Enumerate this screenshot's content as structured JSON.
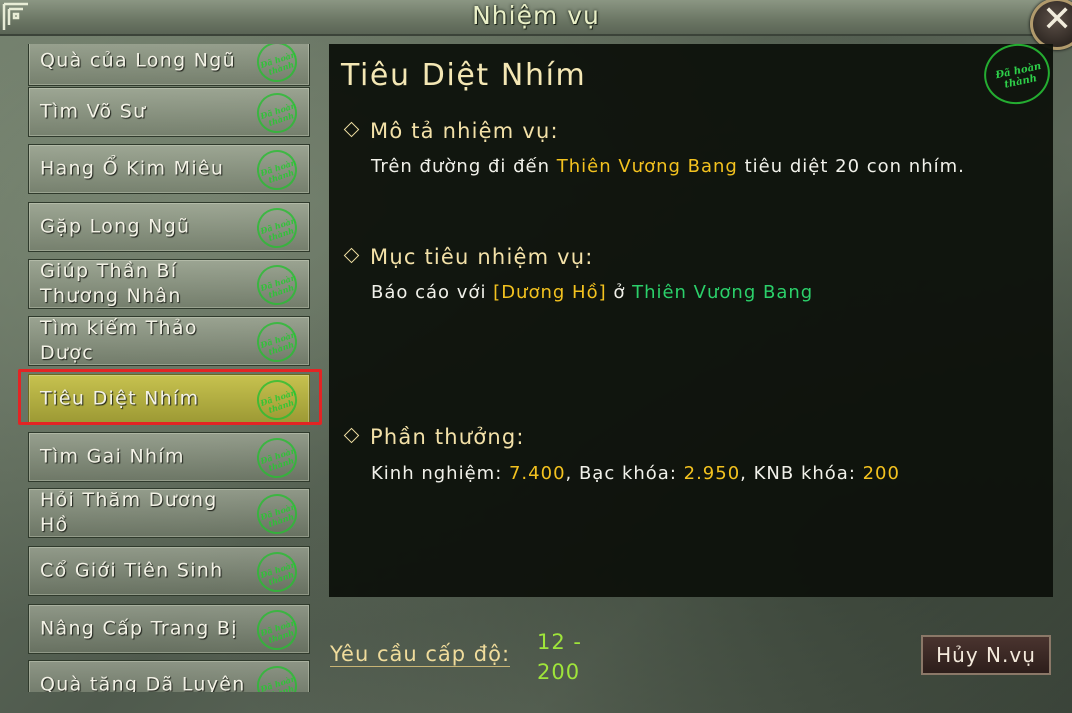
{
  "window": {
    "title": "Nhiệm vụ",
    "close_icon": "close-icon"
  },
  "quest_list": [
    {
      "label": "Quà của Long Ngũ",
      "stamp": "Đã hoàn thành"
    },
    {
      "label": "Tìm Võ Sư",
      "stamp": "Đã hoàn thành"
    },
    {
      "label": "Hang Ổ Kim Miêu",
      "stamp": "Đã hoàn thành"
    },
    {
      "label": "Gặp Long Ngũ",
      "stamp": "Đã hoàn thành"
    },
    {
      "label": "Giúp Thần Bí Thương Nhân",
      "stamp": "Đã hoàn thành"
    },
    {
      "label": "Tìm kiếm Thảo Dược",
      "stamp": "Đã hoàn thành"
    },
    {
      "label": "Tiêu Diệt Nhím",
      "stamp": "Đã hoàn thành",
      "selected": true
    },
    {
      "label": "Tìm Gai Nhím",
      "stamp": "Đã hoàn thành"
    },
    {
      "label": "Hỏi Thăm Dương Hồ",
      "stamp": "Đã hoàn thành"
    },
    {
      "label": "Cổ Giới Tiên Sinh",
      "stamp": "Đã hoàn thành"
    },
    {
      "label": "Nâng Cấp Trang Bị",
      "stamp": "Đã hoàn thành"
    },
    {
      "label": "Quà tặng Dã Luyện",
      "stamp": "Đã hoàn thành"
    }
  ],
  "detail": {
    "title": "Tiêu Diệt Nhím",
    "status_stamp": "Đã hoàn thành",
    "description": {
      "heading": "Mô tả nhiệm vụ:",
      "text_before": "Trên đường đi đến ",
      "location": "Thiên Vương Bang",
      "text_after": " tiêu diệt 20 con nhím."
    },
    "objective": {
      "heading": "Mục tiêu nhiệm vụ:",
      "text_before": "Báo cáo với ",
      "npc": "[Dương Hồ]",
      "text_mid": " ở ",
      "location": "Thiên Vương Bang"
    },
    "reward": {
      "heading": "Phần thưởng:",
      "exp_label": "Kinh nghiệm: ",
      "exp_value": "7.400",
      "silver_label": ", Bạc khóa: ",
      "silver_value": "2.950",
      "knb_label": ", KNB khóa: ",
      "knb_value": "200"
    }
  },
  "footer": {
    "level_label": "Yêu cầu cấp độ:",
    "level_value": "12 - 200",
    "cancel_label": "Hủy N.vụ"
  },
  "colors": {
    "highlight": "#f3c21f",
    "location": "#2bd06a",
    "level": "#9fe53a",
    "selection_box": "#e32424"
  }
}
